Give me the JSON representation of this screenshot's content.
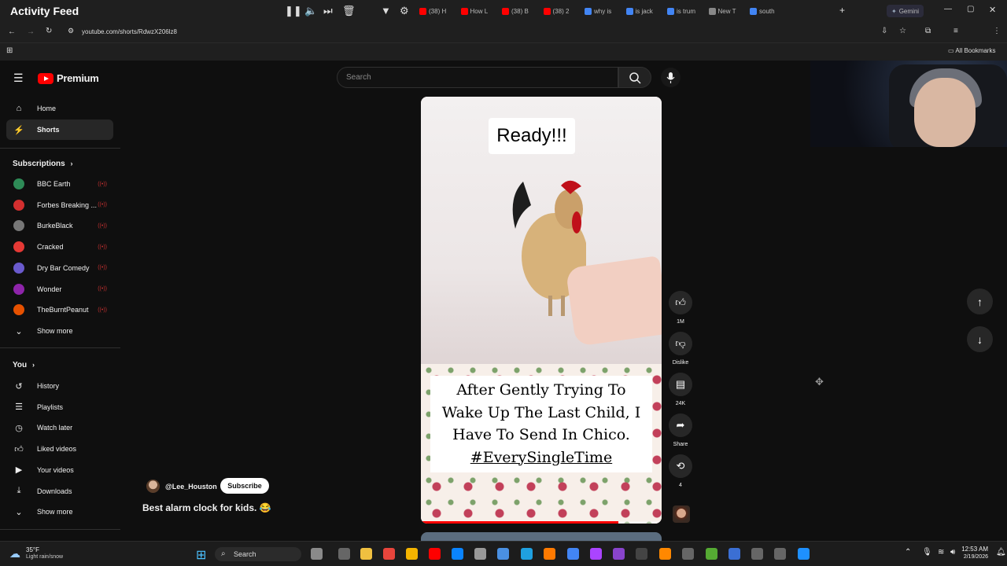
{
  "app_title": "Activity Feed",
  "tabs": [
    {
      "label": "(38) H",
      "color": "#ff0000"
    },
    {
      "label": "How L",
      "color": "#ff0000"
    },
    {
      "label": "(38) B",
      "color": "#ff0000"
    },
    {
      "label": "(38) 2",
      "color": "#ff0000"
    },
    {
      "label": "why is",
      "color": "#4285f4"
    },
    {
      "label": "is jack",
      "color": "#4285f4"
    },
    {
      "label": "is trum",
      "color": "#4285f4"
    },
    {
      "label": "New T",
      "color": "#888888"
    },
    {
      "label": "south",
      "color": "#4285f4"
    }
  ],
  "gemini_label": "Gemini",
  "url": "youtube.com/shorts/RdwzX206lz8",
  "all_bookmarks": "All Bookmarks",
  "yt": {
    "logo_label": "Premium",
    "search_placeholder": "Search"
  },
  "sidebar": {
    "main": [
      {
        "label": "Home",
        "icon": "home-icon"
      },
      {
        "label": "Shorts",
        "icon": "shorts-icon",
        "active": true
      }
    ],
    "subscriptions_title": "Subscriptions",
    "subscriptions": [
      {
        "label": "BBC Earth",
        "color": "#2e8b57"
      },
      {
        "label": "Forbes Breaking ...",
        "color": "#d32f2f"
      },
      {
        "label": "BurkeBlack",
        "color": "#777777"
      },
      {
        "label": "Cracked",
        "color": "#e53935"
      },
      {
        "label": "Dry Bar Comedy",
        "color": "#6a5acd"
      },
      {
        "label": "Wonder",
        "color": "#8e24aa"
      },
      {
        "label": "TheBurntPeanut",
        "color": "#e65100"
      }
    ],
    "show_more_1": "Show more",
    "you_title": "You",
    "you": [
      {
        "label": "History",
        "icon": "history-icon"
      },
      {
        "label": "Playlists",
        "icon": "playlists-icon"
      },
      {
        "label": "Watch later",
        "icon": "watch-later-icon"
      },
      {
        "label": "Liked videos",
        "icon": "thumbs-up-icon"
      },
      {
        "label": "Your videos",
        "icon": "your-videos-icon"
      },
      {
        "label": "Downloads",
        "icon": "download-icon"
      }
    ],
    "show_more_2": "Show more"
  },
  "short": {
    "ready_text": "Ready!!!",
    "caption_lines": [
      "After Gently Trying To",
      "Wake Up The Last Child, I",
      "Have To Send In Chico."
    ],
    "caption_tag": "#EverySingleTime",
    "progress": 0.82,
    "channel": "@Lee_Houston",
    "subscribe": "Subscribe",
    "title": "Best alarm clock for kids. 😂"
  },
  "actions": {
    "likes": "1M",
    "dislike": "Dislike",
    "comments": "24K",
    "share": "Share",
    "remix": "4"
  },
  "taskbar": {
    "temp": "35°F",
    "weather": "Light rain/snow",
    "search": "Search",
    "time": "12:53 AM",
    "date": "2/19/2026"
  }
}
